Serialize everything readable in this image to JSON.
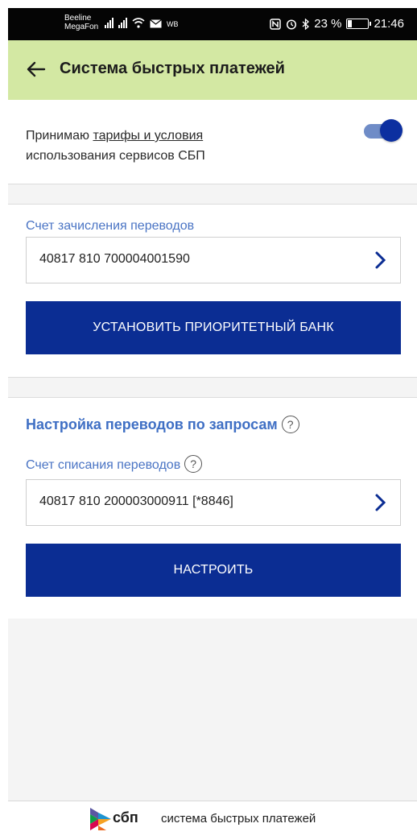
{
  "status_bar": {
    "carrier_1": "Beeline",
    "carrier_2": "MegaFon",
    "extra": "WB",
    "battery": "23 %",
    "time": "21:46"
  },
  "header": {
    "title": "Система быстрых платежей"
  },
  "terms": {
    "prefix": "Принимаю ",
    "link": "тарифы и условия",
    "suffix": "использования сервисов СБП",
    "accepted": true
  },
  "incoming": {
    "label": "Счет зачисления переводов",
    "account": "40817 810 700004001590",
    "button": "УСТАНОВИТЬ ПРИОРИТЕТНЫЙ БАНК"
  },
  "requests": {
    "title": "Настройка переводов по запросам",
    "label": "Счет списания переводов",
    "account": "40817 810 200003000911 [*8846]",
    "button": "НАСТРОИТЬ"
  },
  "footer": {
    "short": "сбп",
    "long": "система быстрых платежей"
  },
  "colors": {
    "header_bg": "#d3e8a3",
    "accent": "#0b2d93",
    "link_blue": "#4a74c4"
  }
}
